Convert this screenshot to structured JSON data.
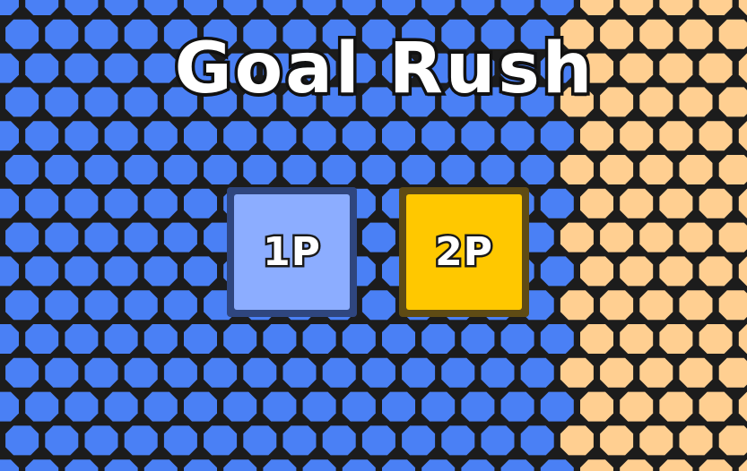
{
  "game": {
    "title": "Goal Rush"
  },
  "menu": {
    "buttons": [
      {
        "label": "1P",
        "selected": false
      },
      {
        "label": "2P",
        "selected": true
      }
    ]
  },
  "colors": {
    "background_dark": "#1c1c1c",
    "field_blue": "#4a80f5",
    "field_orange": "#ffcf91",
    "button_1p_fill": "#8cadff",
    "button_1p_frame": "#2f467f",
    "button_2p_fill": "#ffc800",
    "button_2p_frame": "#5f4b14",
    "title_fill": "#ffffff",
    "title_outline": "#111111"
  }
}
